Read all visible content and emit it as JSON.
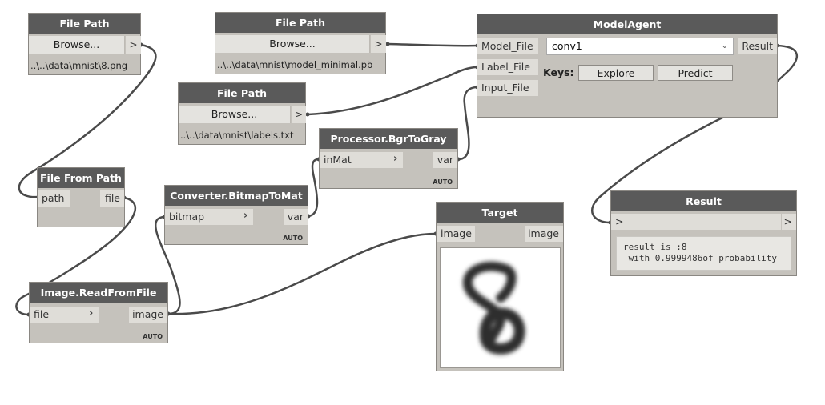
{
  "nodes": {
    "file_path_1": {
      "title": "File Path",
      "browse": "Browse...",
      "out": ">",
      "path": "..\\..\\data\\mnist\\8.png"
    },
    "file_path_2": {
      "title": "File Path",
      "browse": "Browse...",
      "out": ">",
      "path": "..\\..\\data\\mnist\\model_minimal.pb"
    },
    "file_path_3": {
      "title": "File Path",
      "browse": "Browse...",
      "out": ">",
      "path": "..\\..\\data\\mnist\\labels.txt"
    },
    "model_agent": {
      "title": "ModelAgent",
      "inputs": [
        "Model_File",
        "Label_File",
        "Input_File"
      ],
      "output": "Result",
      "dropdown_value": "conv1",
      "keys_label": "Keys:",
      "explore_label": "Explore",
      "predict_label": "Predict"
    },
    "file_from_path": {
      "title": "File From Path",
      "in": "path",
      "out": "file"
    },
    "converter": {
      "title": "Converter.BitmapToMat",
      "in": "bitmap",
      "out": "var",
      "auto": "AUTO"
    },
    "processor": {
      "title": "Processor.BgrToGray",
      "in": "inMat",
      "out": "var",
      "auto": "AUTO"
    },
    "image_read": {
      "title": "Image.ReadFromFile",
      "in": "file",
      "out": "image",
      "auto": "AUTO"
    },
    "target": {
      "title": "Target",
      "in": "image",
      "out": "image"
    },
    "result": {
      "title": "Result",
      "in": ">",
      "out": ">",
      "text": "result is :8\n with 0.9999486of probability"
    }
  },
  "colors": {
    "canvas": "#ffffff",
    "node_body": "#c5c2bc",
    "node_header": "#5a5a5a",
    "wire": "#4a4a4a"
  },
  "icons": {
    "port_chevron": "chevron-right-icon",
    "dropdown": "chevron-down-icon"
  }
}
